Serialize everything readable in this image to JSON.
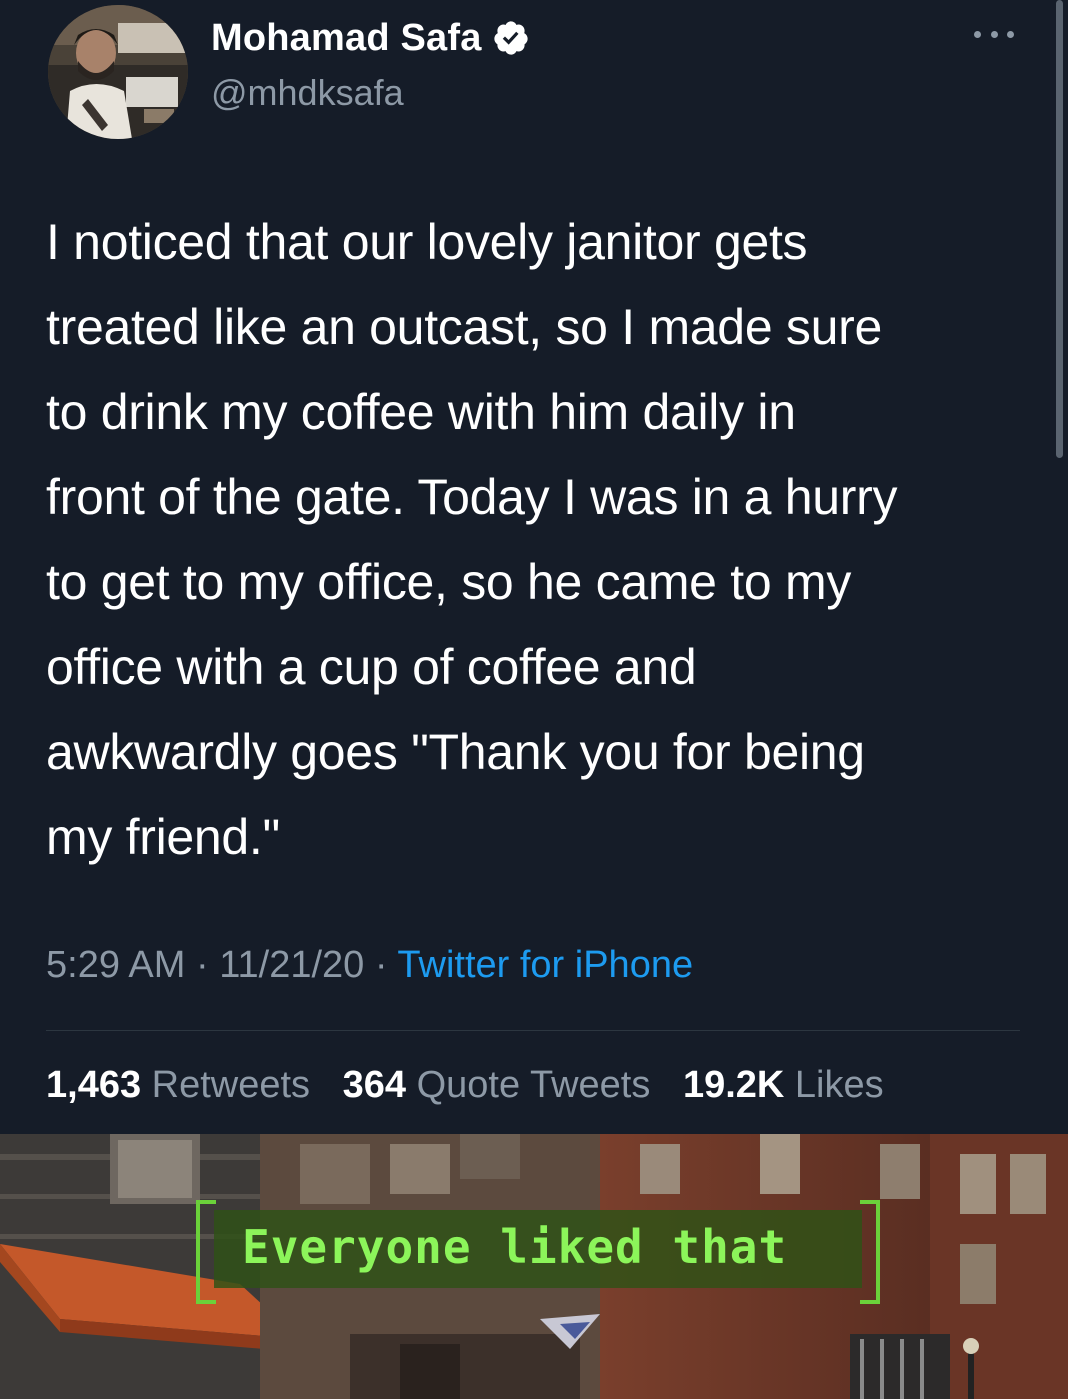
{
  "tweet": {
    "author_name": "Mohamad Safa",
    "author_handle": "@mhdksafa",
    "verified": true,
    "avatar_icon": "avatar-photo",
    "text": "I noticed that our lovely janitor gets\ntreated like an outcast, so I made sure\nto drink my coffee with him daily in\nfront of the gate. Today I was in a hurry\nto get to my office, so he came to my\noffice with a cup of coffee and\nawkwardly goes \"Thank you for being\nmy friend.\"",
    "time": "5:29 AM",
    "date": "11/21/20",
    "separator": "·",
    "source": "Twitter for iPhone",
    "stats": {
      "retweets_count": "1,463",
      "retweets_label": "Retweets",
      "quotes_count": "364",
      "quotes_label": "Quote Tweets",
      "likes_count": "19.2K",
      "likes_label": "Likes"
    }
  },
  "meme": {
    "caption": "Everyone liked that"
  },
  "colors": {
    "background": "#151c28",
    "text": "#ffffff",
    "secondary": "#8d99a6",
    "link": "#1d9bf0",
    "verified": "#ffffff",
    "caption_green": "#8cf55a"
  }
}
